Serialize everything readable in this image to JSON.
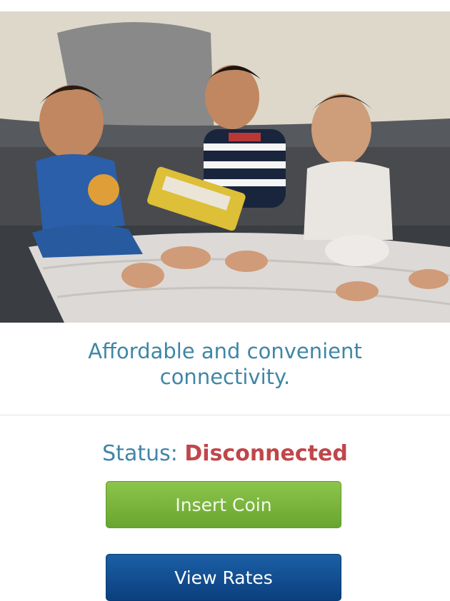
{
  "hero": {
    "image_name": "three-children-on-couch-photo"
  },
  "tagline": "Affordable and convenient connectivity.",
  "status": {
    "label": "Status:",
    "value": "Disconnected",
    "value_color": "#c0464a"
  },
  "buttons": {
    "insert_coin": "Insert Coin",
    "view_rates": "View Rates"
  },
  "colors": {
    "accent_text": "#3f86a6",
    "insert_coin_bg": "#77b13b",
    "view_rates_bg": "#124a8c"
  }
}
